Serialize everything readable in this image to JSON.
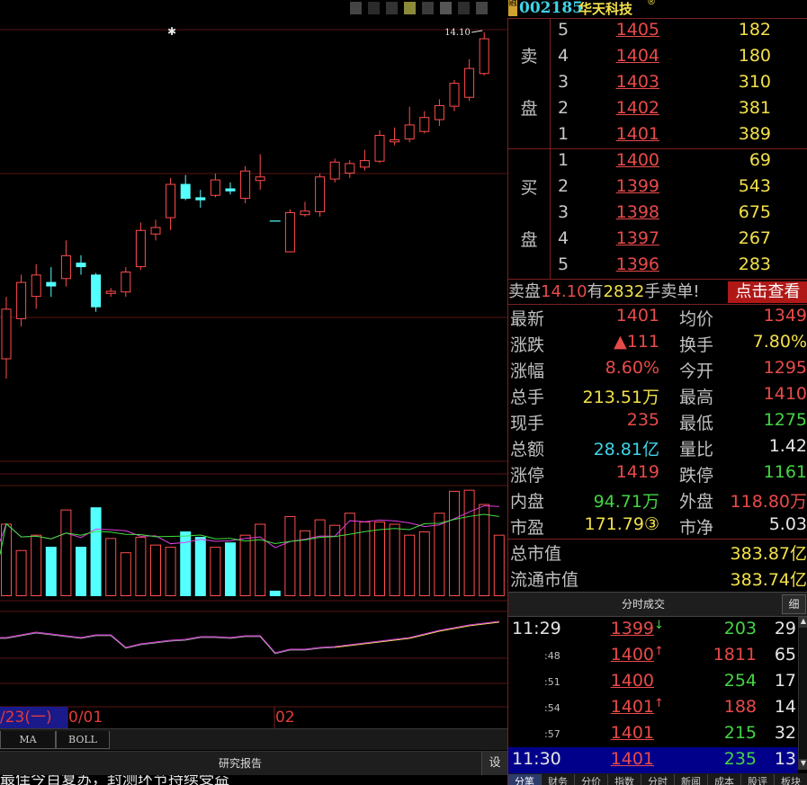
{
  "stock": {
    "code": "002185",
    "name": "华天科技",
    "name_mark": "®",
    "badge": "融"
  },
  "chart_data": {
    "type": "candlestick",
    "max_label": "14.10",
    "date_labels": [
      "/23(一)",
      "0/01",
      "02"
    ],
    "candles": [
      {
        "o": 12.18,
        "c": 12.52,
        "h": 12.6,
        "l": 12.05,
        "dir": "up"
      },
      {
        "o": 12.45,
        "c": 12.7,
        "h": 12.75,
        "l": 12.4,
        "dir": "up"
      },
      {
        "o": 12.6,
        "c": 12.75,
        "h": 12.82,
        "l": 12.52,
        "dir": "up"
      },
      {
        "o": 12.67,
        "c": 12.7,
        "h": 12.8,
        "l": 12.6,
        "dir": "down"
      },
      {
        "o": 12.72,
        "c": 12.88,
        "h": 12.98,
        "l": 12.67,
        "dir": "up"
      },
      {
        "o": 12.83,
        "c": 12.8,
        "h": 12.88,
        "l": 12.75,
        "dir": "down"
      },
      {
        "o": 12.75,
        "c": 12.53,
        "h": 12.76,
        "l": 12.5,
        "dir": "down"
      },
      {
        "o": 12.62,
        "c": 12.64,
        "h": 12.66,
        "l": 12.6,
        "dir": "up"
      },
      {
        "o": 12.63,
        "c": 12.77,
        "h": 12.8,
        "l": 12.6,
        "dir": "up"
      },
      {
        "o": 12.8,
        "c": 13.05,
        "h": 13.1,
        "l": 12.78,
        "dir": "up"
      },
      {
        "o": 13.02,
        "c": 13.07,
        "h": 13.12,
        "l": 12.98,
        "dir": "up"
      },
      {
        "o": 13.13,
        "c": 13.36,
        "h": 13.4,
        "l": 13.05,
        "dir": "up"
      },
      {
        "o": 13.36,
        "c": 13.26,
        "h": 13.42,
        "l": 13.25,
        "dir": "down"
      },
      {
        "o": 13.27,
        "c": 13.25,
        "h": 13.32,
        "l": 13.2,
        "dir": "down"
      },
      {
        "o": 13.28,
        "c": 13.39,
        "h": 13.43,
        "l": 13.27,
        "dir": "up"
      },
      {
        "o": 13.33,
        "c": 13.31,
        "h": 13.37,
        "l": 13.29,
        "dir": "down"
      },
      {
        "o": 13.26,
        "c": 13.45,
        "h": 13.48,
        "l": 13.23,
        "dir": "up"
      },
      {
        "o": 13.38,
        "c": 13.41,
        "h": 13.56,
        "l": 13.32,
        "dir": "up"
      },
      {
        "o": 13.11,
        "c": 13.11,
        "h": 13.11,
        "l": 13.11,
        "dir": "doji"
      },
      {
        "o": 12.9,
        "c": 13.17,
        "h": 13.19,
        "l": 12.9,
        "dir": "up"
      },
      {
        "o": 13.15,
        "c": 13.18,
        "h": 13.24,
        "l": 13.14,
        "dir": "up"
      },
      {
        "o": 13.17,
        "c": 13.41,
        "h": 13.43,
        "l": 13.14,
        "dir": "up"
      },
      {
        "o": 13.39,
        "c": 13.51,
        "h": 13.53,
        "l": 13.37,
        "dir": "up"
      },
      {
        "o": 13.43,
        "c": 13.5,
        "h": 13.52,
        "l": 13.4,
        "dir": "up"
      },
      {
        "o": 13.47,
        "c": 13.52,
        "h": 13.59,
        "l": 13.45,
        "dir": "up"
      },
      {
        "o": 13.51,
        "c": 13.69,
        "h": 13.72,
        "l": 13.5,
        "dir": "up"
      },
      {
        "o": 13.64,
        "c": 13.66,
        "h": 13.74,
        "l": 13.62,
        "dir": "up"
      },
      {
        "o": 13.66,
        "c": 13.76,
        "h": 13.88,
        "l": 13.64,
        "dir": "up"
      },
      {
        "o": 13.71,
        "c": 13.81,
        "h": 13.85,
        "l": 13.7,
        "dir": "up"
      },
      {
        "o": 13.79,
        "c": 13.89,
        "h": 13.93,
        "l": 13.75,
        "dir": "up"
      },
      {
        "o": 13.88,
        "c": 14.04,
        "h": 14.06,
        "l": 13.85,
        "dir": "up"
      },
      {
        "o": 13.94,
        "c": 14.14,
        "h": 14.2,
        "l": 13.92,
        "dir": "up"
      },
      {
        "o": 14.1,
        "c": 14.34,
        "h": 14.38,
        "l": 14.09,
        "dir": "up"
      }
    ],
    "volume": [
      66,
      42,
      56,
      45,
      79,
      45,
      81,
      53,
      40,
      54,
      47,
      45,
      59,
      54,
      45,
      49,
      56,
      66,
      5,
      73,
      60,
      70,
      65,
      76,
      68,
      68,
      66,
      56,
      59,
      76,
      96,
      97,
      84,
      56
    ],
    "volume_dir": [
      "up",
      "up",
      "up",
      "down",
      "up",
      "down",
      "down",
      "up",
      "up",
      "up",
      "up",
      "up",
      "down",
      "down",
      "up",
      "down",
      "up",
      "up",
      "doji",
      "up",
      "up",
      "up",
      "up",
      "up",
      "up",
      "up",
      "up",
      "up",
      "up",
      "up",
      "up",
      "up",
      "up",
      "up"
    ]
  },
  "indicator_tabs": [
    "MA",
    "BOLL"
  ],
  "report_button": "研究报告",
  "settings_button": "设",
  "news_ticker": "最佳今百复苏，封测环节持续受益",
  "orderbook": {
    "sell_label_1": "卖",
    "sell_label_2": "盘",
    "buy_label_1": "买",
    "buy_label_2": "盘",
    "asks": [
      {
        "level": "5",
        "price": "1405",
        "vol": "182"
      },
      {
        "level": "4",
        "price": "1404",
        "vol": "180"
      },
      {
        "level": "3",
        "price": "1403",
        "vol": "310"
      },
      {
        "level": "2",
        "price": "1402",
        "vol": "381"
      },
      {
        "level": "1",
        "price": "1401",
        "vol": "389"
      }
    ],
    "bids": [
      {
        "level": "1",
        "price": "1400",
        "vol": "69"
      },
      {
        "level": "2",
        "price": "1399",
        "vol": "543"
      },
      {
        "level": "3",
        "price": "1398",
        "vol": "675"
      },
      {
        "level": "4",
        "price": "1397",
        "vol": "267"
      },
      {
        "level": "5",
        "price": "1396",
        "vol": "283"
      }
    ]
  },
  "sell_alert": {
    "p1": "卖盘",
    "price": "14.10",
    "p2": "有",
    "qty": "2832",
    "p3": "手卖单!",
    "button": "点击查看"
  },
  "quote": [
    {
      "l1": "最新",
      "v1": "1401",
      "c1": "red",
      "l2": "均价",
      "v2": "1349",
      "c2": "red"
    },
    {
      "l1": "涨跌",
      "v1": "▲111",
      "c1": "red",
      "l2": "换手",
      "v2": "7.80%",
      "c2": "yellow"
    },
    {
      "l1": "涨幅",
      "v1": "8.60%",
      "c1": "red",
      "l2": "今开",
      "v2": "1295",
      "c2": "red"
    },
    {
      "l1": "总手",
      "v1": "213.51万",
      "c1": "yellow",
      "l2": "最高",
      "v2": "1410",
      "c2": "red"
    },
    {
      "l1": "现手",
      "v1": "235",
      "c1": "red",
      "l2": "最低",
      "v2": "1275",
      "c2": "green"
    },
    {
      "l1": "总额",
      "v1": "28.81亿",
      "c1": "cyan",
      "l2": "量比",
      "v2": "1.42",
      "c2": "white"
    },
    {
      "l1": "涨停",
      "v1": "1419",
      "c1": "red",
      "l2": "跌停",
      "v2": "1161",
      "c2": "green"
    },
    {
      "l1": "内盘",
      "v1": "94.71万",
      "c1": "green",
      "l2": "外盘",
      "v2": "118.80万",
      "c2": "red"
    },
    {
      "l1": "市盈",
      "v1": "171.79③",
      "c1": "yellow",
      "l2": "市净",
      "v2": "5.03",
      "c2": "white"
    }
  ],
  "market_value": [
    {
      "label": "总市值",
      "value": "383.87亿"
    },
    {
      "label": "流通市值",
      "value": "383.74亿"
    }
  ],
  "ticks": {
    "title": "分时成交",
    "detail_button": "细",
    "rows": [
      {
        "time": "11:29",
        "small": false,
        "price": "1399",
        "pc": "red",
        "arrow": "↓",
        "ac": "green",
        "vol": "203",
        "vc": "green",
        "cnt": "29"
      },
      {
        "time": ":48",
        "small": true,
        "price": "1400",
        "pc": "red",
        "arrow": "↑",
        "ac": "red",
        "vol": "1811",
        "vc": "red",
        "cnt": "65"
      },
      {
        "time": ":51",
        "small": true,
        "price": "1400",
        "pc": "red",
        "arrow": "",
        "ac": "red",
        "vol": "254",
        "vc": "green",
        "cnt": "17"
      },
      {
        "time": ":54",
        "small": true,
        "price": "1401",
        "pc": "red",
        "arrow": "↑",
        "ac": "red",
        "vol": "188",
        "vc": "red",
        "cnt": "14"
      },
      {
        "time": ":57",
        "small": true,
        "price": "1401",
        "pc": "red",
        "arrow": "",
        "ac": "red",
        "vol": "215",
        "vc": "green",
        "cnt": "32"
      },
      {
        "time": "11:30",
        "small": false,
        "price": "1401",
        "pc": "red",
        "arrow": "",
        "ac": "red",
        "vol": "235",
        "vc": "green",
        "cnt": "13",
        "current": true
      }
    ]
  },
  "bottom_tabs": [
    "分笔",
    "财务",
    "分价",
    "指数",
    "分时",
    "新闻",
    "成本",
    "股评",
    "板块"
  ]
}
